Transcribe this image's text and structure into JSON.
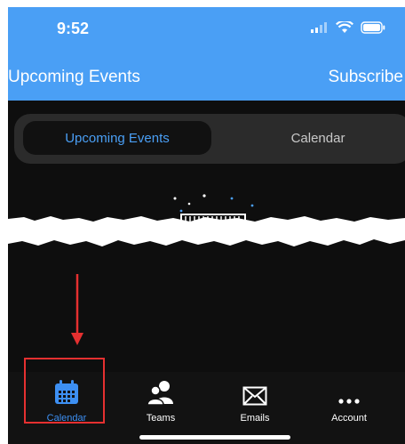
{
  "status_bar": {
    "time": "9:52"
  },
  "nav": {
    "title": "Upcoming Events",
    "action": "Subscribe"
  },
  "segmented": {
    "selected": "Upcoming Events",
    "other": "Calendar"
  },
  "tabs": [
    {
      "label": "Calendar",
      "icon": "calendar-icon",
      "active": true
    },
    {
      "label": "Teams",
      "icon": "teams-icon",
      "active": false
    },
    {
      "label": "Emails",
      "icon": "mail-icon",
      "active": false
    },
    {
      "label": "Account",
      "icon": "more-icon",
      "active": false
    }
  ],
  "colors": {
    "accent": "#4a9ff5",
    "annotation": "#e53030",
    "background": "#0e0e0e"
  }
}
